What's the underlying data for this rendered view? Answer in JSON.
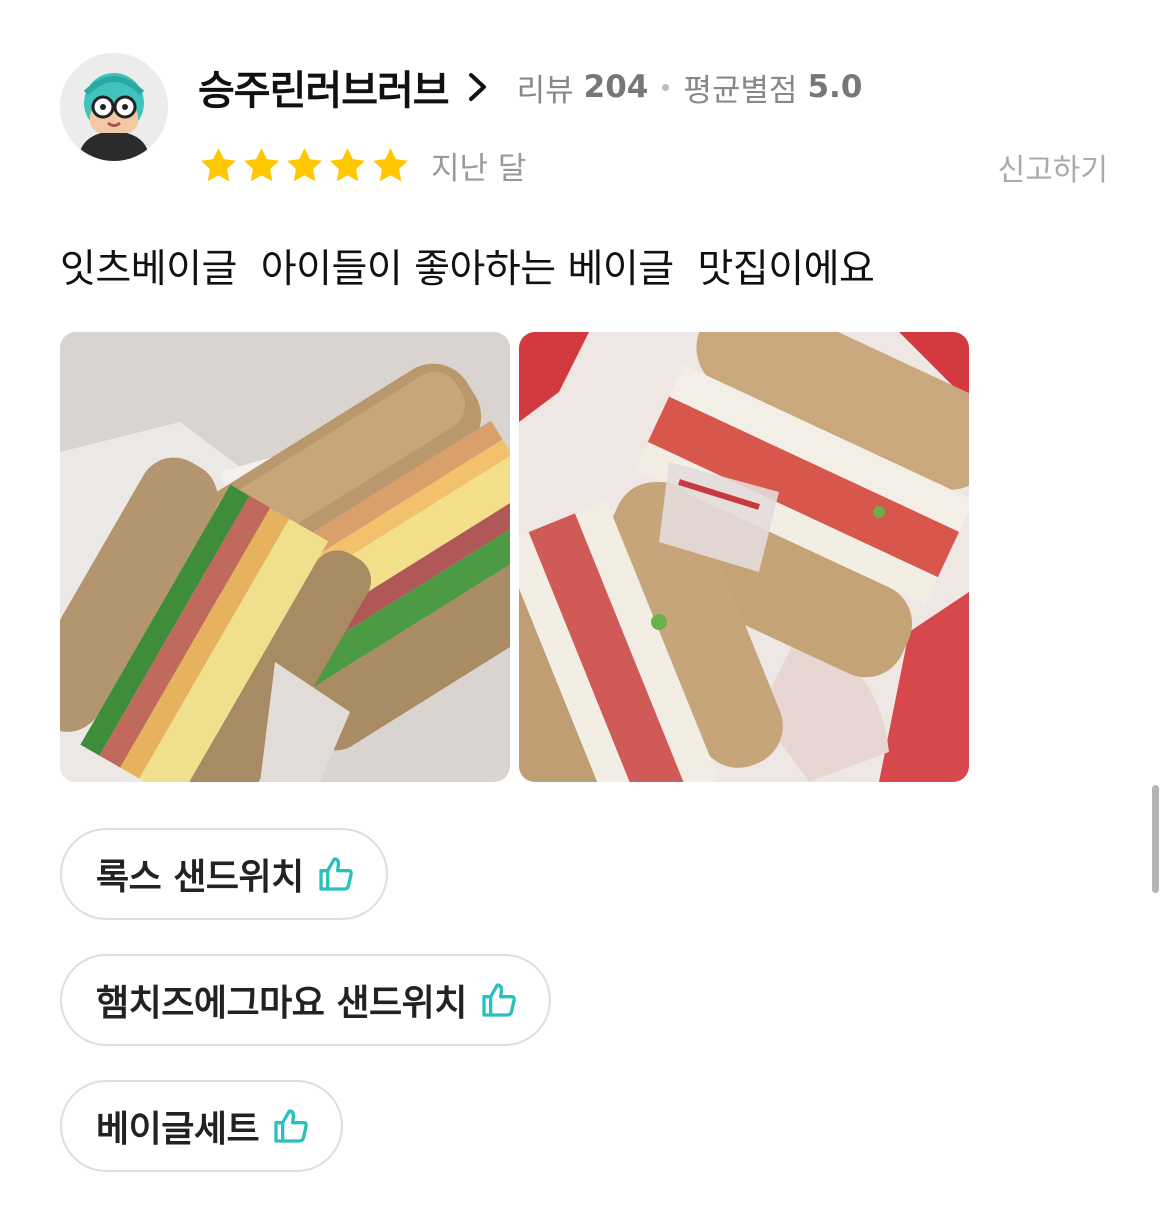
{
  "reviewer": {
    "nickname": "승주린러브러브",
    "review_label": "리뷰",
    "review_count": "204",
    "avg_rating_label": "평균별점",
    "avg_rating": "5.0"
  },
  "review": {
    "star_count": 5,
    "rating_value": 5,
    "date": "지난 달",
    "report_label": "신고하기",
    "text": "잇츠베이글  아이들이 좋아하는 베이글  맛집이에요"
  },
  "photos": [
    {
      "icon": "ham-cheese-egg-mayo-bagel-photo"
    },
    {
      "icon": "lox-sandwich-bagel-photo"
    }
  ],
  "menu_tags": [
    {
      "label": "록스 샌드위치",
      "icon": "thumbs-up-icon"
    },
    {
      "label": "햄치즈에그마요 샌드위치",
      "icon": "thumbs-up-icon"
    },
    {
      "label": "베이글세트",
      "icon": "thumbs-up-icon"
    }
  ],
  "colors": {
    "star": "#FFC700",
    "thumb": "#2AC1BC",
    "meta_text": "#888888"
  }
}
